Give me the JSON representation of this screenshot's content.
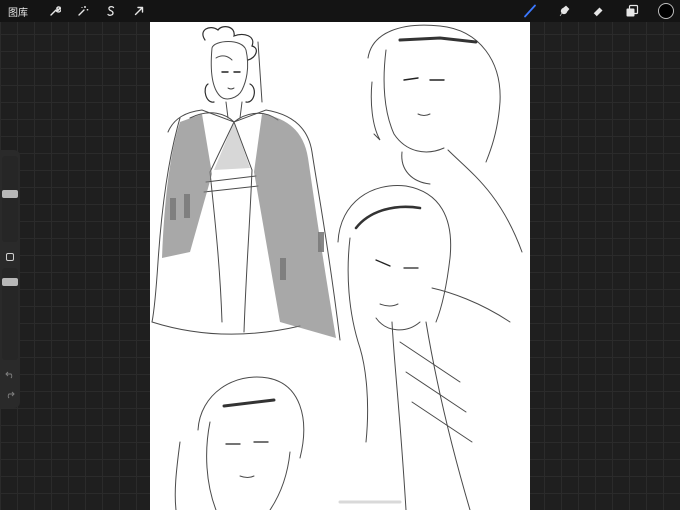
{
  "topbar": {
    "gallery_label": "图库",
    "left_tools": [
      "wrench-icon",
      "magic-wand-icon",
      "selection-s-icon",
      "transform-arrow-icon"
    ],
    "right_tools": [
      "brush-icon",
      "smudge-icon",
      "eraser-icon",
      "layers-icon"
    ],
    "active_tool": "brush-icon",
    "accent_color": "#3b78ff",
    "current_color": "#000000"
  },
  "sidebar": {
    "brush_size_level": 0.8,
    "opacity_level": 0.55,
    "icons": [
      "modify-square-icon",
      "undo-icon",
      "redo-icon"
    ]
  }
}
